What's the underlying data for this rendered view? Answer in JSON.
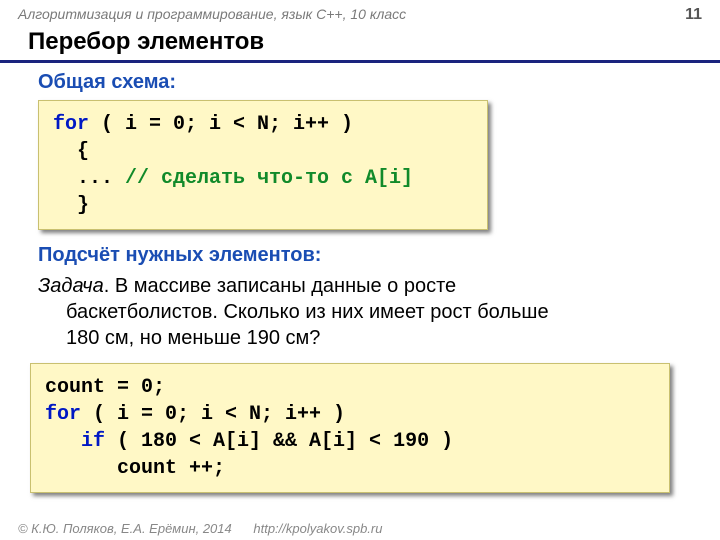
{
  "header": {
    "course": "Алгоритмизация и программирование, язык C++, 10 класс",
    "page": "11"
  },
  "title": "Перебор элементов",
  "section1": "Общая схема:",
  "code1": {
    "kw_for": "for",
    "loop": " ( i = 0; i < N; i++ ) ",
    "open": "  {",
    "dots": "  ... ",
    "comment": "// сделать что-то с A[i]",
    "close": "  }"
  },
  "section2": "Подсчёт нужных элементов:",
  "task": {
    "label": "Задача",
    "text1": ". В массиве записаны данные о росте",
    "text2": "баскетболистов. Сколько из них имеет рост больше",
    "text3": "180 см, но меньше 190 см?"
  },
  "code2": {
    "line1": "count = 0;",
    "kw_for": "for",
    "loop": " ( i = 0; i < N; i++ ) ",
    "kw_if": "   if",
    "cond": " ( 180 < A[i] && A[i] < 190 )",
    "inc": "      count ++;"
  },
  "footer": {
    "authors": "© К.Ю. Поляков, Е.А. Ерёмин, 2014",
    "url": "http://kpolyakov.spb.ru"
  }
}
